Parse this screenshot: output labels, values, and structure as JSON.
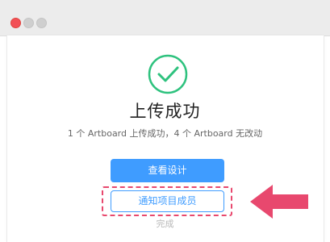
{
  "window": {
    "title": ""
  },
  "dialog": {
    "title": "上传成功",
    "subtitle": "1 个 Artboard 上传成功，4 个 Artboard 无改动",
    "primary_button": "查看设计",
    "secondary_button": "通知项目成员",
    "done_link": "完成"
  },
  "colors": {
    "accent": "#3f9cff",
    "success": "#2ec27e",
    "highlight": "#e8486e"
  },
  "icons": {
    "success": "check-circle-icon",
    "annotation": "arrow-left-icon"
  }
}
